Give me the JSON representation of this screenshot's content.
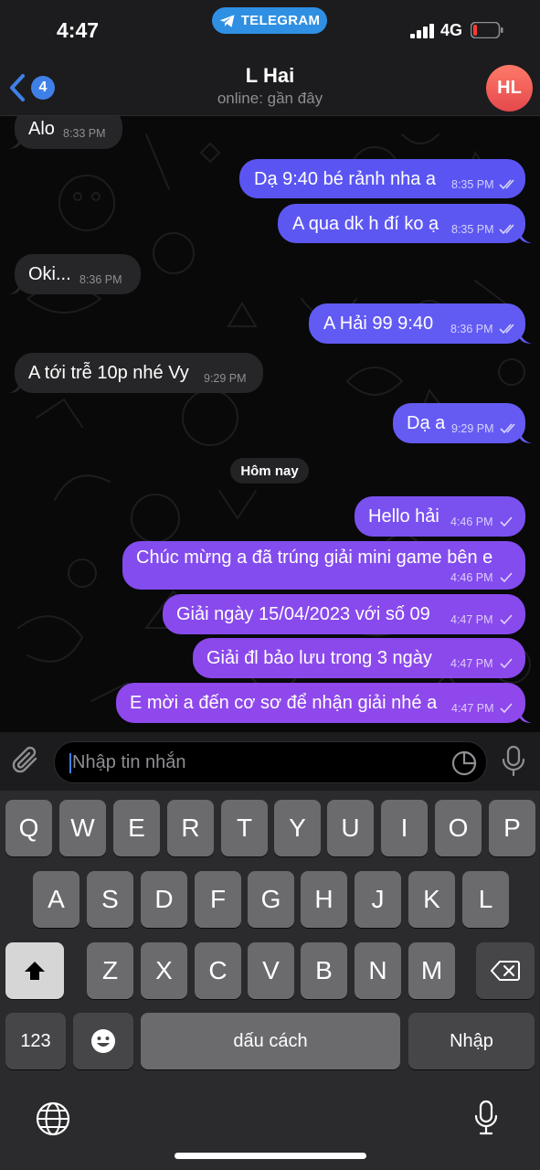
{
  "status_bar": {
    "time": "4:47",
    "app_badge": "TELEGRAM",
    "network": "4G"
  },
  "header": {
    "back_count": "4",
    "title": "L Hai",
    "status": "online: gần đây",
    "avatar_initials": "HL"
  },
  "messages": [
    {
      "side": "in",
      "text": "Alo",
      "time": "8:33 PM"
    },
    {
      "side": "out",
      "text": "Dạ 9:40 bé rảnh nha a",
      "time": "8:35 PM",
      "read": true
    },
    {
      "side": "out",
      "text": "A qua dk h đí ko ạ",
      "time": "8:35 PM",
      "read": true
    },
    {
      "side": "in",
      "text": "Oki...",
      "time": "8:36 PM"
    },
    {
      "side": "out",
      "text": "A Hải 99 9:40",
      "time": "8:36 PM",
      "read": true
    },
    {
      "side": "in",
      "text": "A tới trễ 10p nhé Vy",
      "time": "9:29 PM"
    },
    {
      "side": "out",
      "text": "Dạ a",
      "time": "9:29 PM",
      "read": true
    },
    {
      "side": "out",
      "text": "Hello hải",
      "time": "4:46 PM",
      "read": false
    },
    {
      "side": "out",
      "text": "Chúc mừng a đã trúng giải mini game bên e",
      "time": "4:46 PM",
      "read": false
    },
    {
      "side": "out",
      "text": "Giải ngày 15/04/2023 với số 09",
      "time": "4:47 PM",
      "read": false
    },
    {
      "side": "out",
      "text": "Giải đl bảo lưu trong 3 ngày",
      "time": "4:47 PM",
      "read": false
    },
    {
      "side": "out",
      "text": "E mời a đến cơ sơ để nhận giải nhé a",
      "time": "4:47 PM",
      "read": false
    }
  ],
  "date_separator": "Hôm nay",
  "composer": {
    "placeholder": "Nhập tin nhắn"
  },
  "keyboard": {
    "row1": [
      "Q",
      "W",
      "E",
      "R",
      "T",
      "Y",
      "U",
      "I",
      "O",
      "P"
    ],
    "row2": [
      "A",
      "S",
      "D",
      "F",
      "G",
      "H",
      "J",
      "K",
      "L"
    ],
    "row3": [
      "Z",
      "X",
      "C",
      "V",
      "B",
      "N",
      "M"
    ],
    "numbers_key": "123",
    "space_key": "dấu cách",
    "return_key": "Nhập"
  },
  "colors": {
    "accent": "#3f80e8",
    "bubble_in": "#262628",
    "bubble_out_blue": "#5b5cf5",
    "bubble_out_purple": "#8b49ea",
    "avatar": "#ee5b55"
  }
}
